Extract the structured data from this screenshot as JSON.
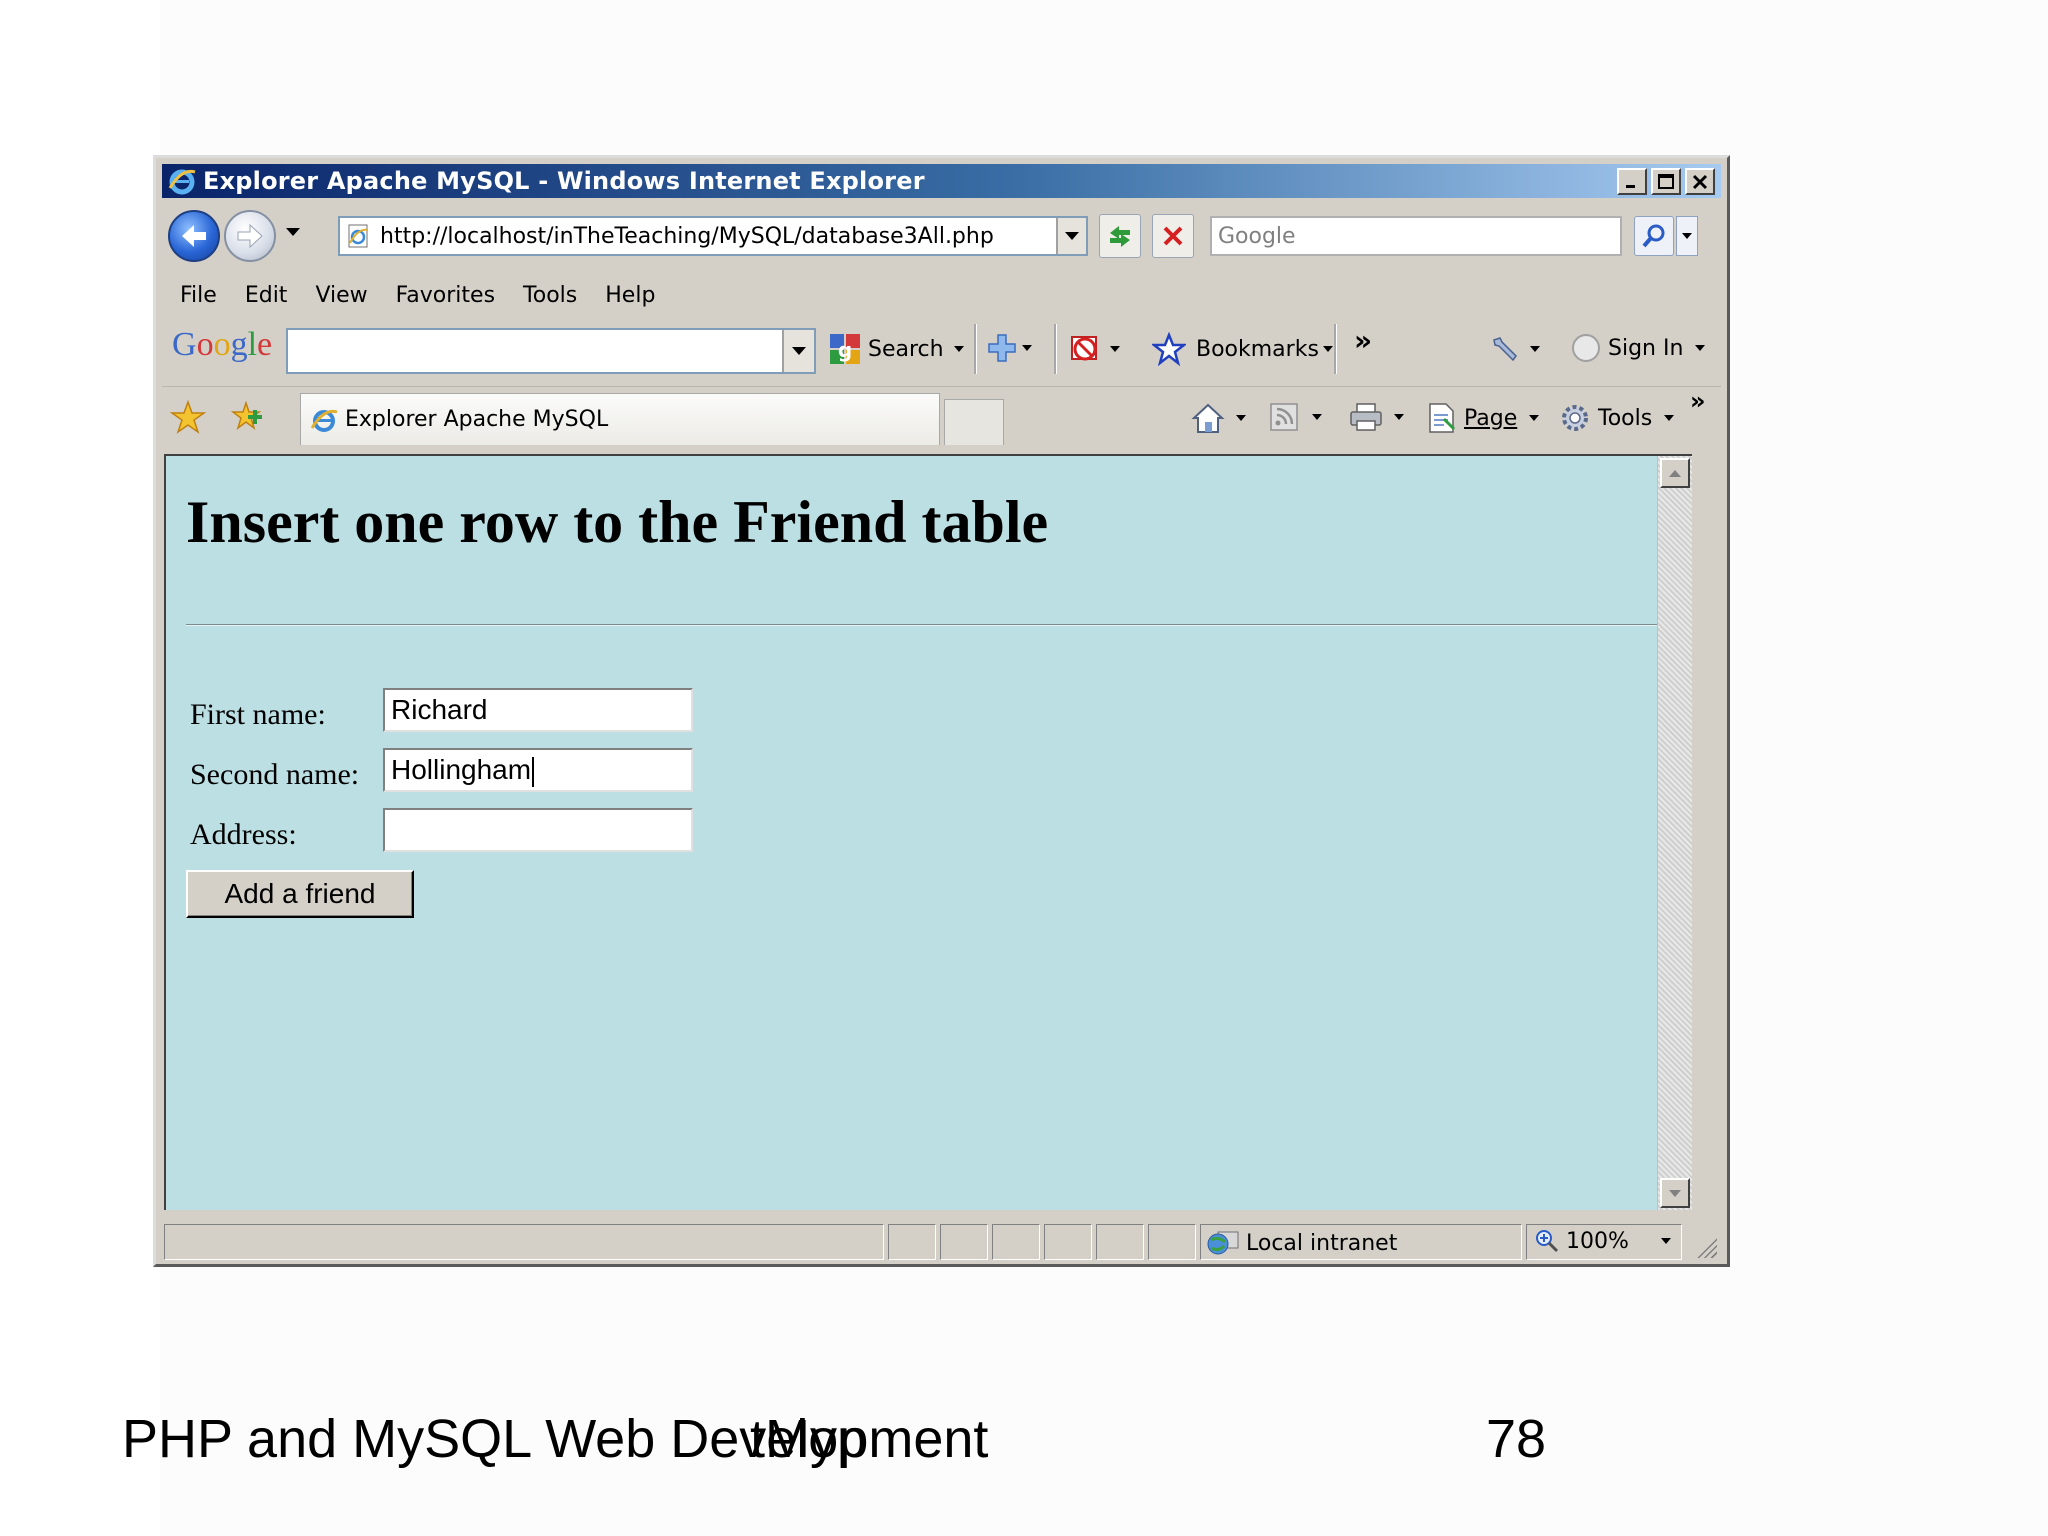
{
  "window": {
    "title": "Explorer Apache MySQL - Windows Internet Explorer"
  },
  "address_bar": {
    "url": "http://localhost/inTheTeaching/MySQL/database3All.php"
  },
  "search_bar": {
    "placeholder": "Google"
  },
  "menu": {
    "items": [
      "File",
      "Edit",
      "View",
      "Favorites",
      "Tools",
      "Help"
    ]
  },
  "google_toolbar": {
    "search_label": "Search",
    "bookmarks_label": "Bookmarks",
    "more": "»",
    "sign_in_label": "Sign In"
  },
  "tabs": {
    "active_label": "Explorer Apache MySQL"
  },
  "command_bar": {
    "page_label": "Page",
    "tools_label": "Tools",
    "more": "»"
  },
  "page": {
    "heading": "Insert one row to the Friend table",
    "form": {
      "first_name_label": "First name:",
      "first_name_value": "Richard",
      "second_name_label": "Second name:",
      "second_name_value": "Hollingham",
      "address_label": "Address:",
      "address_value": "",
      "submit_label": "Add a friend"
    }
  },
  "status_bar": {
    "zone": "Local intranet",
    "zoom": "100%"
  },
  "slide": {
    "footer_title": "PHP and MySQL Web Development",
    "footer_overlap_text": "tMyp",
    "page_number": "78"
  }
}
